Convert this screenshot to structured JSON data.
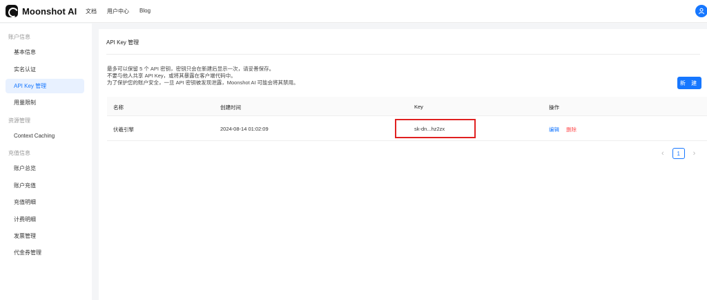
{
  "app": {
    "name": "Moonshot AI"
  },
  "nav": {
    "items": [
      "文档",
      "用户中心",
      "Blog"
    ]
  },
  "sidebar": {
    "groups": [
      {
        "title": "账户信息",
        "items": [
          "基本信息",
          "实名认证",
          "API Key 管理",
          "用量限制"
        ]
      },
      {
        "title": "资源管理",
        "items": [
          "Context Caching"
        ]
      },
      {
        "title": "充值信息",
        "items": [
          "账户总览",
          "账户充值",
          "充值明细",
          "计费明细",
          "发票管理",
          "代金券管理"
        ]
      }
    ],
    "active_item": "API Key 管理"
  },
  "main": {
    "title": "API Key 管理",
    "description": [
      "最多可以保留 5 个 API 密钥，密钥只会在新建后显示一次，请妥善保存。",
      "不要与他人共享 API Key，或将其暴露在客户端代码中。",
      "为了保护您的账户安全，一旦 API 密钥被发现泄露，Moonshot AI 可能会将其禁用。"
    ],
    "new_button": "新 建",
    "table": {
      "columns": [
        "名称",
        "创建时间",
        "Key",
        "操作"
      ],
      "rows": [
        {
          "name": "伏羲引擎",
          "created": "2024-08-14 01:02:09",
          "key": "sk-dn...hz2zx",
          "edit": "编辑",
          "delete": "删除"
        }
      ]
    },
    "pagination": {
      "current_page": "1",
      "prev_icon": "chevron-left-icon",
      "next_icon": "chevron-right-icon"
    }
  },
  "colors": {
    "accent": "#1677ff",
    "danger": "#ff4d4f",
    "highlight_box": "#e02020"
  }
}
